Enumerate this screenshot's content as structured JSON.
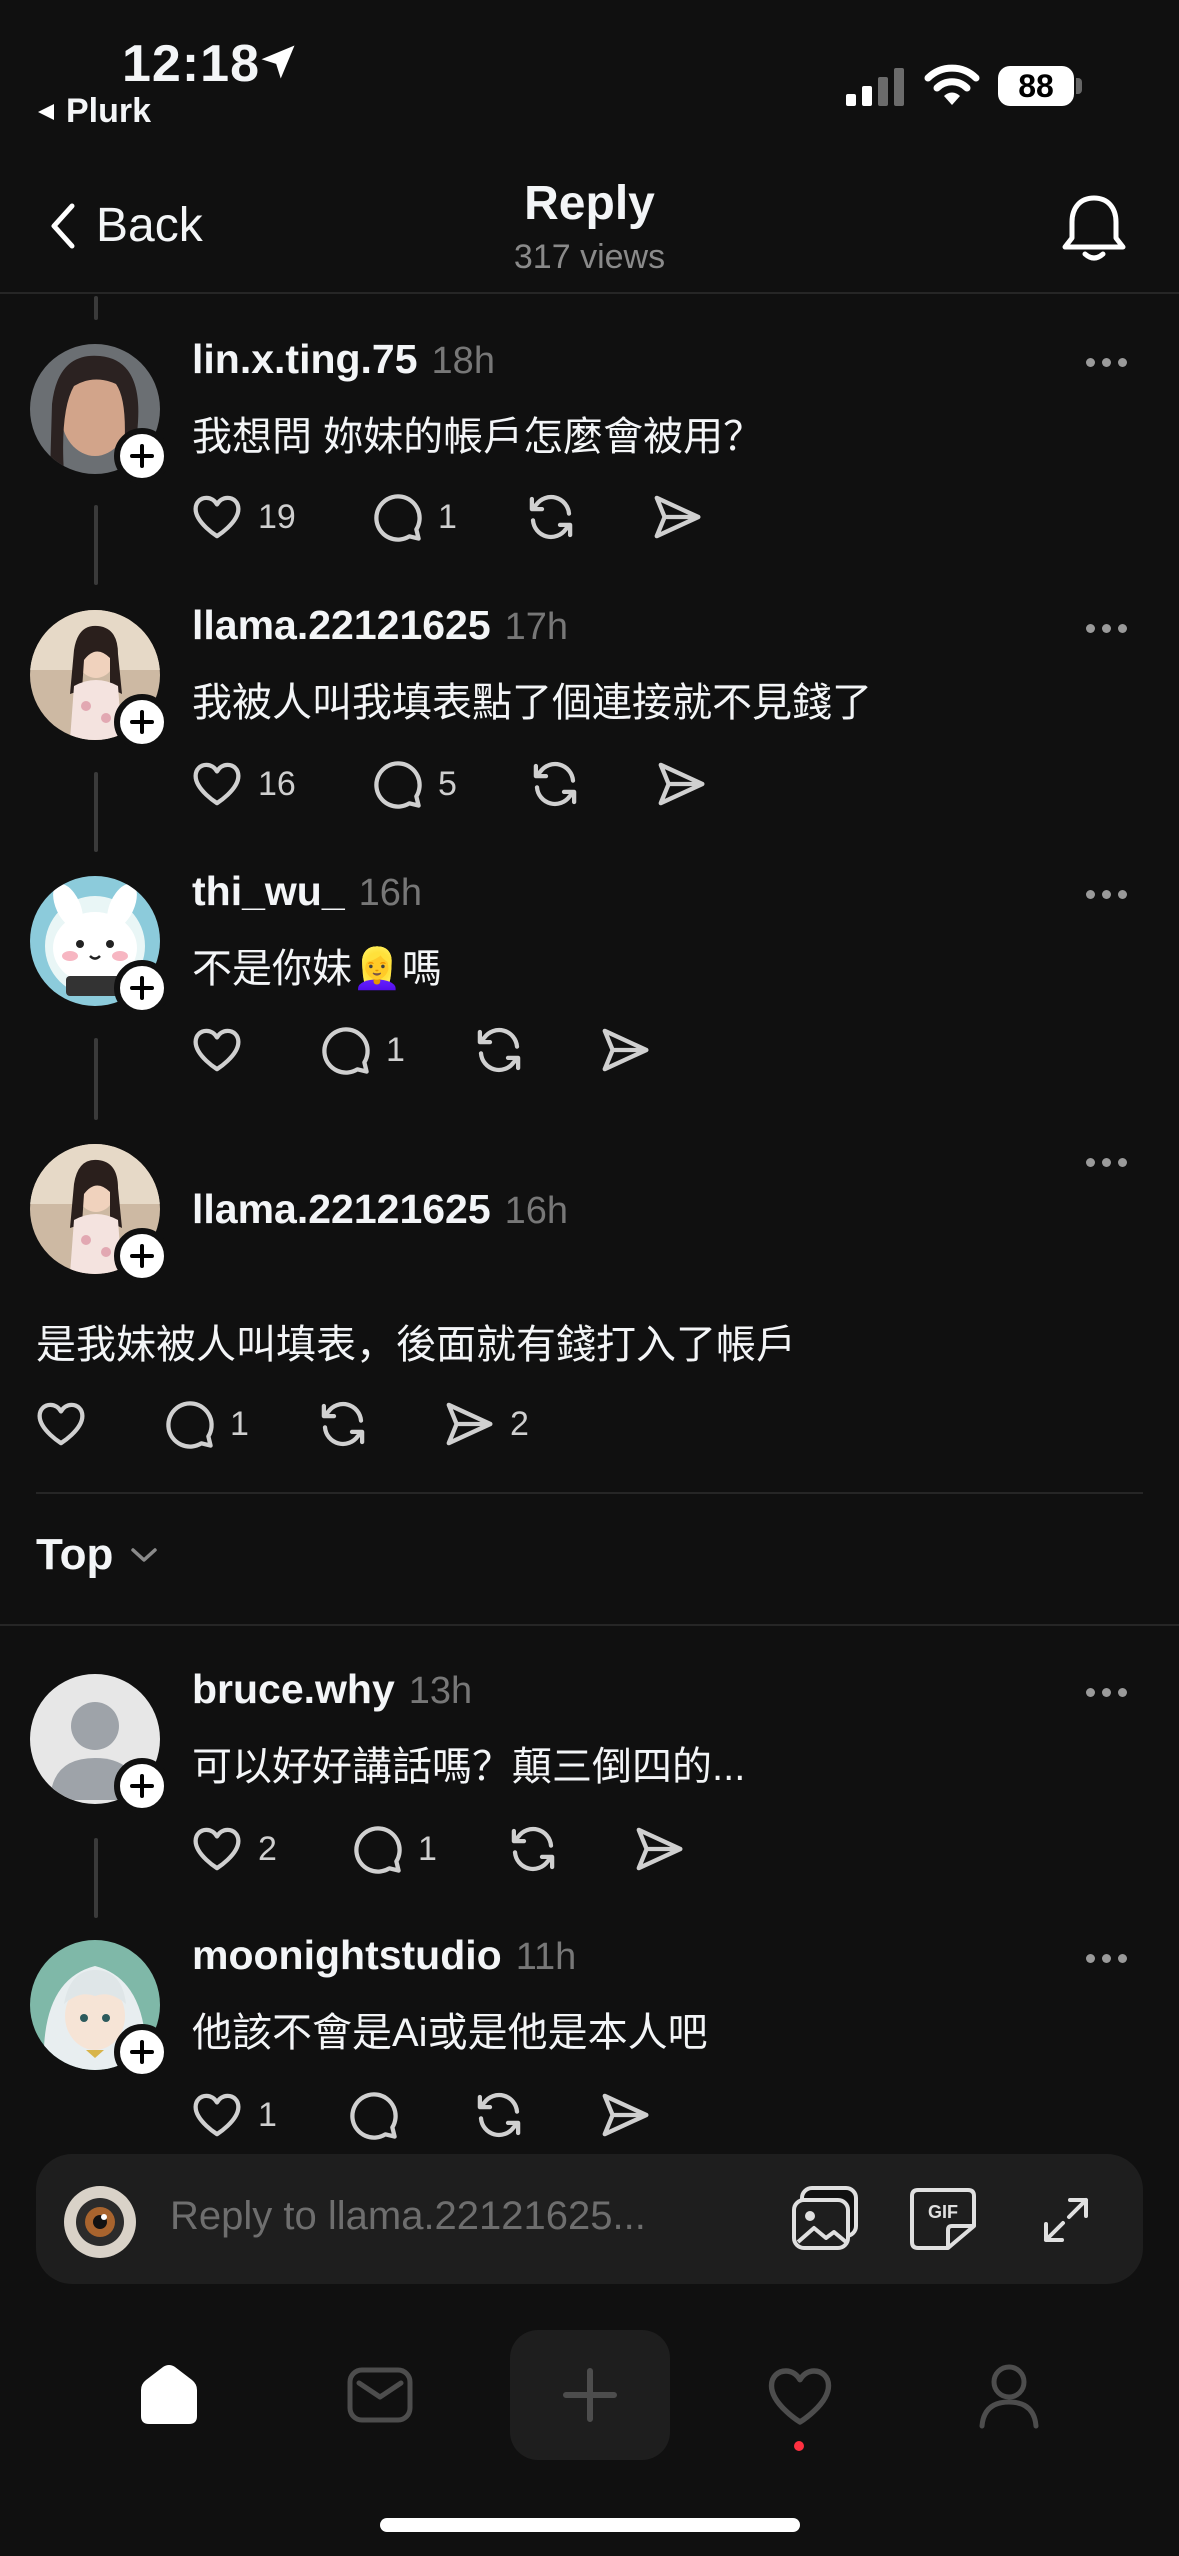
{
  "status_bar": {
    "time": "12:18",
    "back_app": "Plurk",
    "battery": "88"
  },
  "header": {
    "back_label": "Back",
    "title": "Reply",
    "views": "317 views"
  },
  "posts": [
    {
      "username": "lin.x.ting.75",
      "time": "18h",
      "text": "我想問 妳妹的帳戶怎麼會被用？",
      "likes": "19",
      "replies": "1",
      "shares": ""
    },
    {
      "username": "llama.22121625",
      "time": "17h",
      "text": "我被人叫我填表點了個連接就不見錢了",
      "likes": "16",
      "replies": "5",
      "shares": ""
    },
    {
      "username": "thi_wu_",
      "time": "16h",
      "text_before_emoji": "不是你妹",
      "emoji": "👱‍♀️",
      "text_after_emoji": "嗎",
      "likes": "",
      "replies": "1",
      "shares": ""
    },
    {
      "username": "llama.22121625",
      "time": "16h",
      "text": "是我妹被人叫填表，後面就有錢打入了帳戶",
      "likes": "",
      "replies": "1",
      "shares": "2"
    },
    {
      "username": "bruce.why",
      "time": "13h",
      "text": "可以好好講話嗎？顛三倒四的...",
      "likes": "2",
      "replies": "1",
      "shares": ""
    },
    {
      "username": "moonightstudio",
      "time": "11h",
      "text": "他該不會是Ai或是他是本人吧",
      "likes": "1",
      "replies": "",
      "shares": ""
    }
  ],
  "sort": {
    "label": "Top"
  },
  "composer": {
    "placeholder": "Reply to llama.22121625...",
    "gif_label": "GIF"
  },
  "tabs": [
    "home",
    "inbox",
    "create",
    "activity",
    "profile"
  ],
  "colors": {
    "background": "#101010",
    "text": "#f3f5f7",
    "muted": "#777777",
    "notification_dot": "#ff3040"
  }
}
